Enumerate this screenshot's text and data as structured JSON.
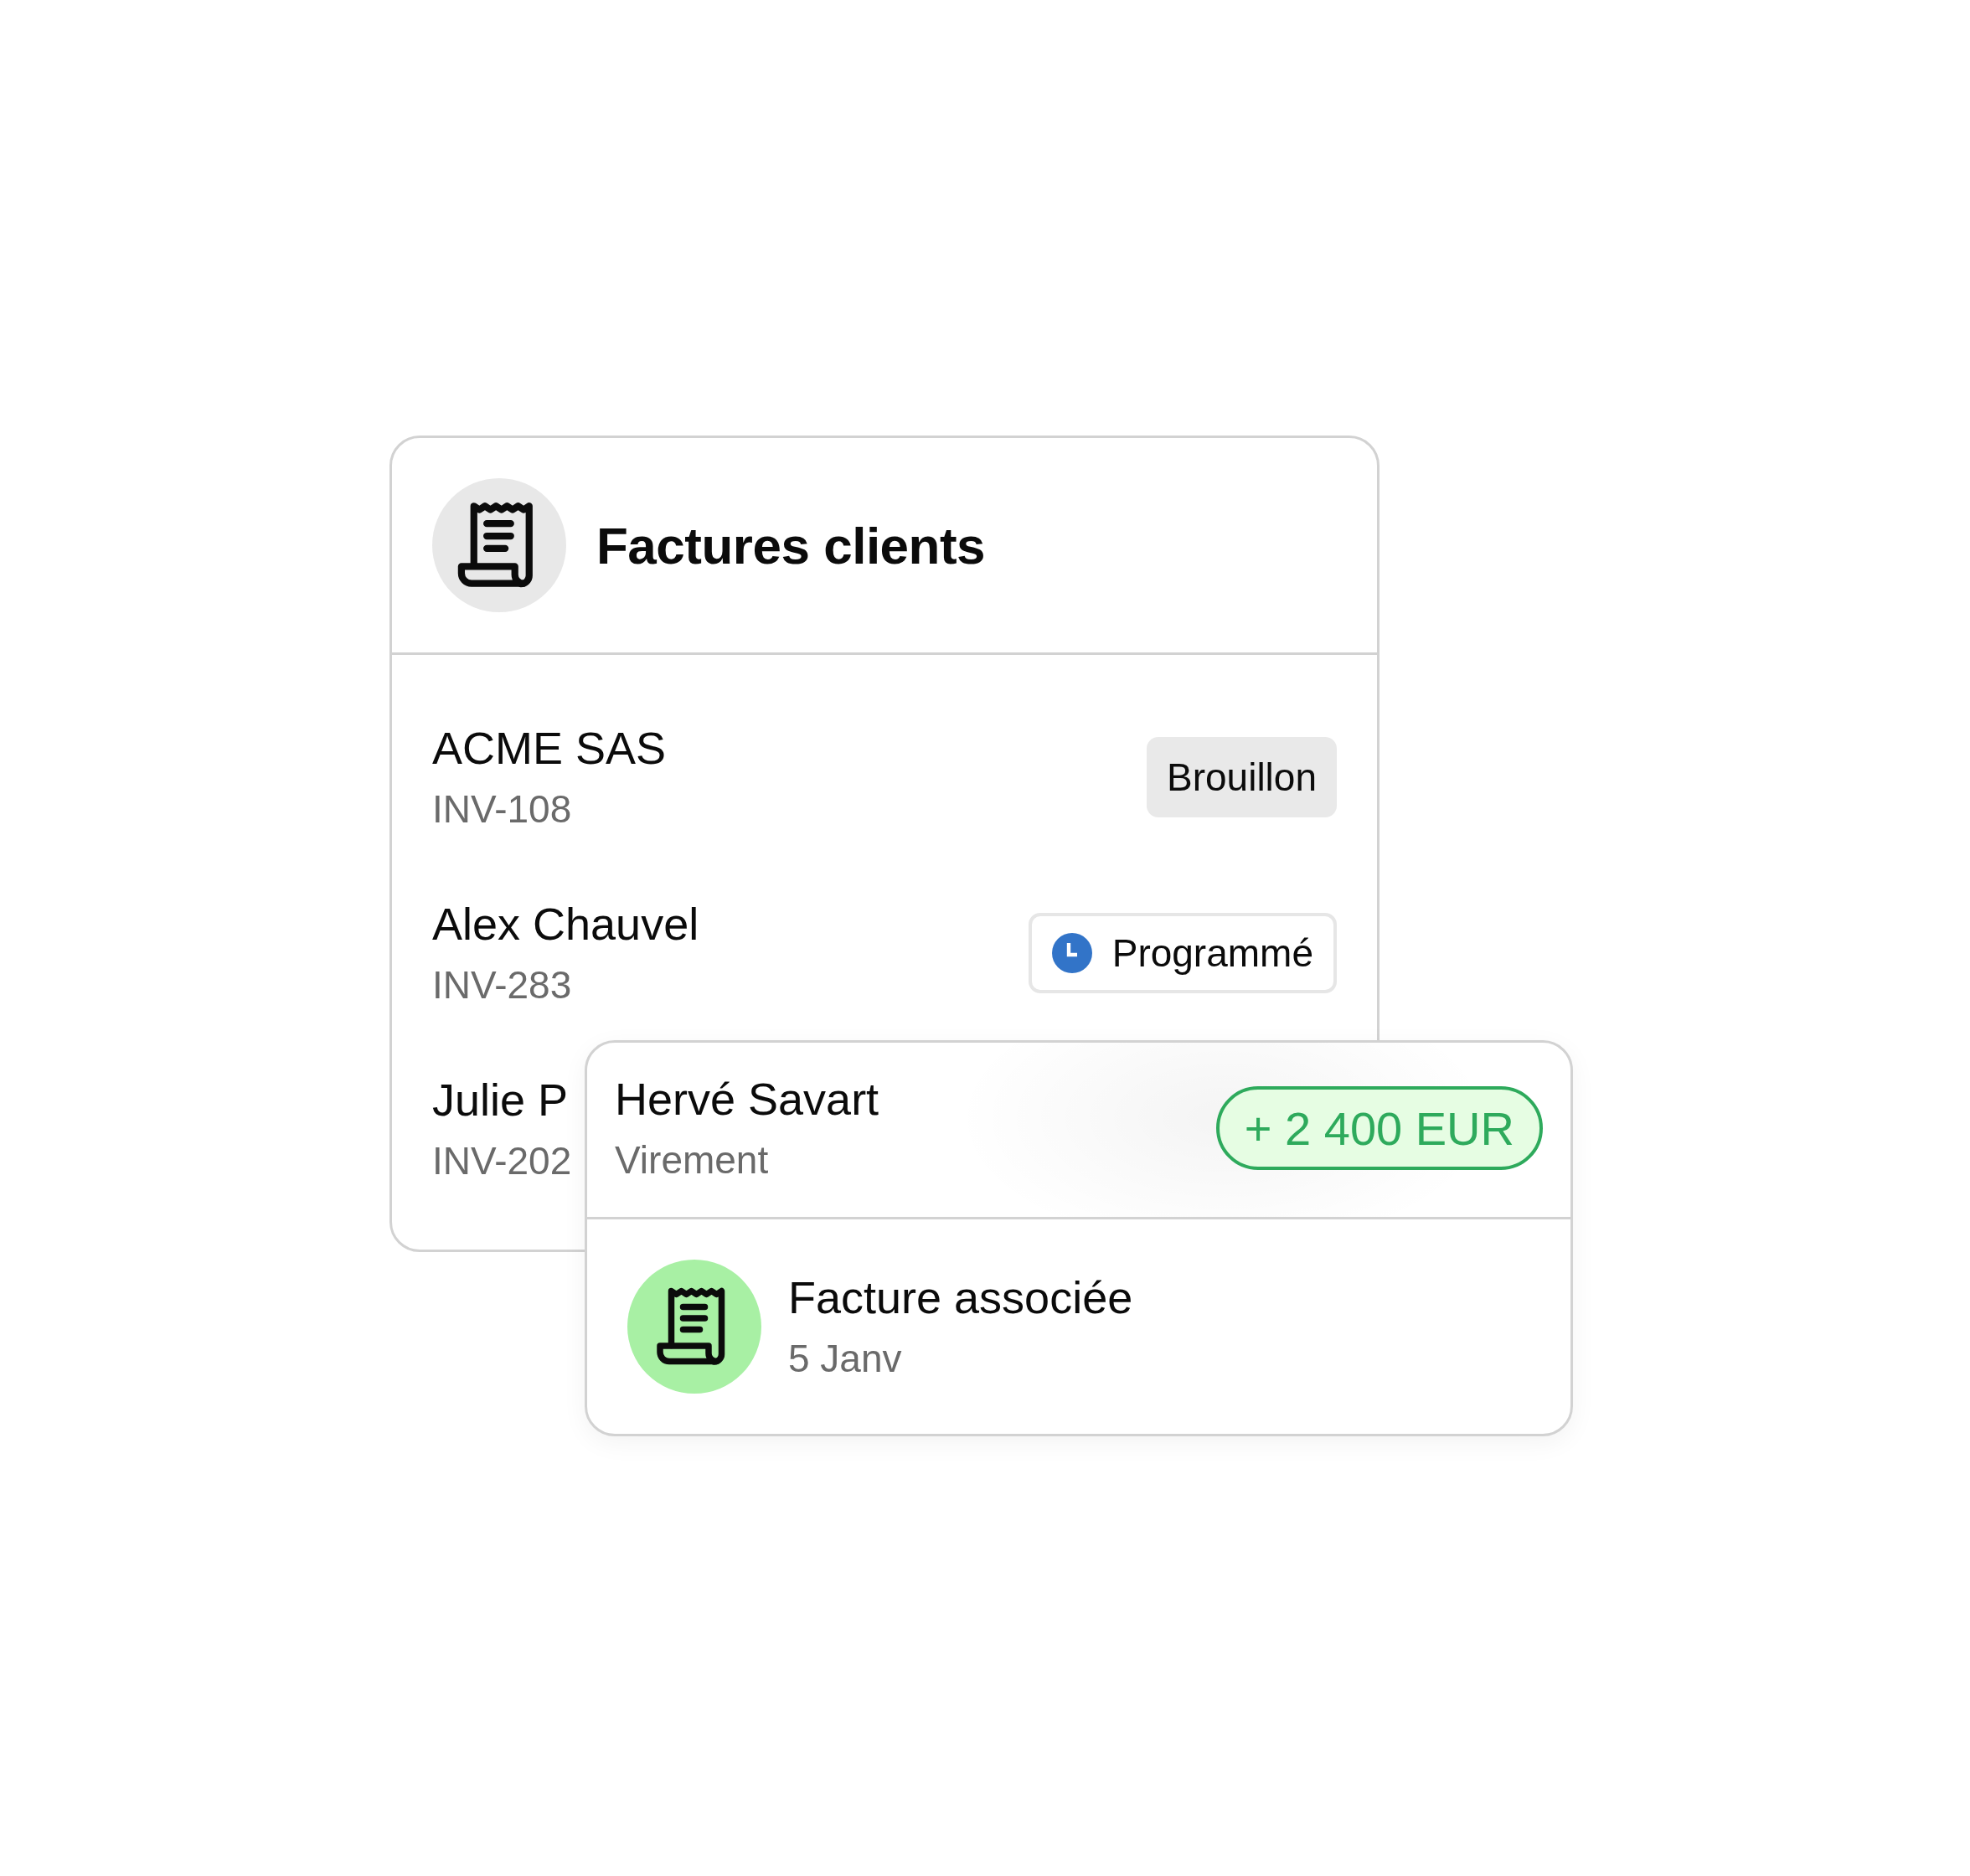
{
  "invoices_card": {
    "title": "Factures clients",
    "rows": [
      {
        "name": "ACME SAS",
        "number": "INV-108",
        "status": {
          "kind": "draft",
          "label": "Brouillon"
        }
      },
      {
        "name": "Alex Chauvel",
        "number": "INV-283",
        "status": {
          "kind": "scheduled",
          "label": "Programmé"
        }
      },
      {
        "name": "Julie P",
        "number": "INV-202"
      }
    ]
  },
  "payment_card": {
    "payer": "Hervé Savart",
    "method": "Virement",
    "amount": "+ 2 400 EUR",
    "linked": {
      "label": "Facture associée",
      "date": "5 Janv"
    }
  }
}
